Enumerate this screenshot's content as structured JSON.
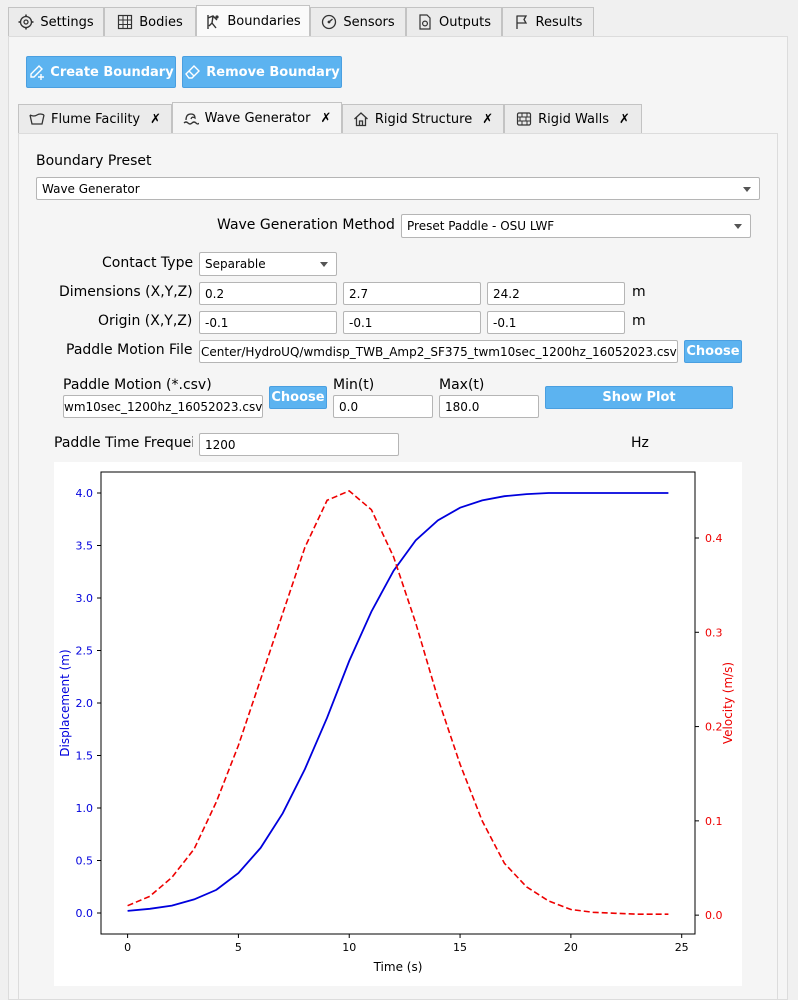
{
  "top_tabs": [
    {
      "label": "Settings",
      "icon": "gear-icon"
    },
    {
      "label": "Bodies",
      "icon": "grid-icon"
    },
    {
      "label": "Boundaries",
      "icon": "wave-person-icon"
    },
    {
      "label": "Sensors",
      "icon": "gauge-icon"
    },
    {
      "label": "Outputs",
      "icon": "file-gear-icon"
    },
    {
      "label": "Results",
      "icon": "flag-icon"
    }
  ],
  "actions": {
    "create": "Create Boundary",
    "remove": "Remove Boundary"
  },
  "boundary_tabs": [
    {
      "label": "Flume Facility",
      "icon": "flume-icon"
    },
    {
      "label": "Wave Generator",
      "icon": "wave-icon"
    },
    {
      "label": "Rigid Structure",
      "icon": "house-icon"
    },
    {
      "label": "Rigid Walls",
      "icon": "wall-icon"
    }
  ],
  "form": {
    "boundary_preset_label": "Boundary Preset",
    "boundary_preset_value": "Wave Generator",
    "wave_method_label": "Wave Generation Method",
    "wave_method_value": "Preset Paddle - OSU LWF",
    "contact_type_label": "Contact Type",
    "contact_type_value": "Separable",
    "dimensions_label": "Dimensions (X,Y,Z)",
    "dimensions": [
      "0.2",
      "2.7",
      "24.2"
    ],
    "dimensions_unit": "m",
    "origin_label": "Origin (X,Y,Z)",
    "origin": [
      "-0.1",
      "-0.1",
      "-0.1"
    ],
    "origin_unit": "m",
    "paddle_file_label": "Paddle Motion File",
    "paddle_file_value": "Center/HydroUQ/wmdisp_TWB_Amp2_SF375_twm10sec_1200hz_16052023.csv",
    "choose_label": "Choose",
    "paddle_csv_label": "Paddle Motion (*.csv)",
    "paddle_csv_value": "wm10sec_1200hz_16052023.csv",
    "mint_label": "Min(t)",
    "mint_value": "0.0",
    "maxt_label": "Max(t)",
    "maxt_value": "180.0",
    "show_plot_label": "Show Plot",
    "freq_label": "Paddle Time Frequei",
    "freq_value": "1200",
    "freq_unit": "Hz"
  },
  "colors": {
    "accent": "#5cb3f0",
    "displacement": "#0000dd",
    "velocity": "#ee0000"
  },
  "chart_data": {
    "type": "line",
    "xlabel": "Time (s)",
    "ylabel": "Displacement (m)",
    "y2label": "Velocity (m/s)",
    "xlim": [
      -1.2,
      25.6
    ],
    "ylim": [
      -0.2,
      4.2
    ],
    "y2lim": [
      -0.02,
      0.47
    ],
    "xticks": [
      0,
      5,
      10,
      15,
      20,
      25
    ],
    "yticks": [
      0.0,
      0.5,
      1.0,
      1.5,
      2.0,
      2.5,
      3.0,
      3.5,
      4.0
    ],
    "y2ticks": [
      0.0,
      0.1,
      0.2,
      0.3,
      0.4
    ],
    "series": [
      {
        "axis": "left",
        "style": "solid",
        "x": [
          0,
          1,
          2,
          3,
          4,
          5,
          6,
          7,
          8,
          9,
          10,
          11,
          12,
          13,
          14,
          15,
          16,
          17,
          18,
          19,
          20,
          21,
          22,
          23,
          24,
          24.4
        ],
        "y": [
          0.02,
          0.04,
          0.07,
          0.13,
          0.22,
          0.38,
          0.62,
          0.95,
          1.37,
          1.86,
          2.4,
          2.87,
          3.26,
          3.55,
          3.74,
          3.86,
          3.93,
          3.97,
          3.99,
          4.0,
          4.0,
          4.0,
          4.0,
          4.0,
          4.0,
          4.0
        ]
      },
      {
        "axis": "right",
        "style": "dashed",
        "x": [
          0,
          1,
          2,
          3,
          4,
          5,
          6,
          7,
          8,
          9,
          10,
          11,
          12,
          13,
          14,
          15,
          16,
          17,
          18,
          19,
          20,
          21,
          22,
          23,
          24,
          24.4
        ],
        "y": [
          0.01,
          0.02,
          0.04,
          0.07,
          0.12,
          0.18,
          0.25,
          0.32,
          0.39,
          0.44,
          0.45,
          0.43,
          0.38,
          0.31,
          0.23,
          0.16,
          0.1,
          0.055,
          0.03,
          0.015,
          0.006,
          0.003,
          0.002,
          0.001,
          0.001,
          0.001
        ]
      }
    ]
  }
}
